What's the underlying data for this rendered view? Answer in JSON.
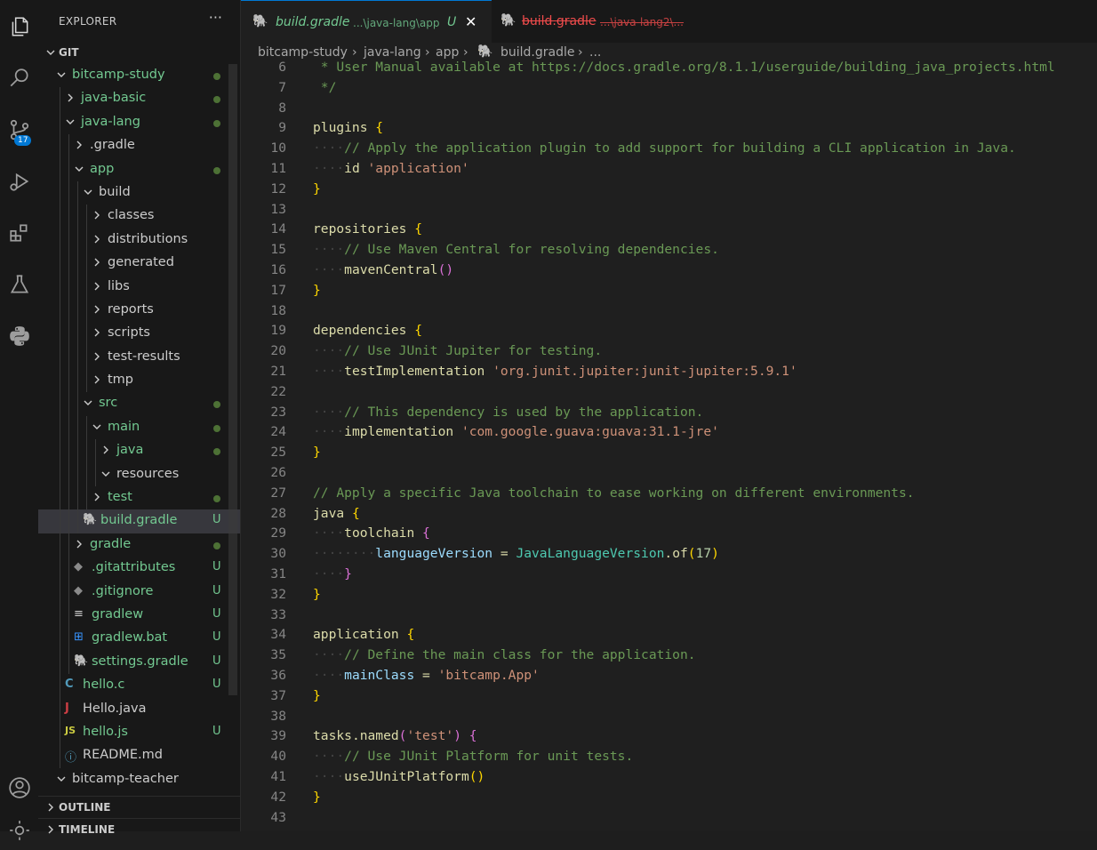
{
  "explorer": {
    "title": "EXPLORER",
    "more": "···",
    "root": "GIT"
  },
  "tree": [
    {
      "label": "bitcamp-study",
      "depth": 1,
      "type": "folder-open",
      "status": "dot",
      "color": "green"
    },
    {
      "label": "java-basic",
      "depth": 2,
      "type": "folder",
      "status": "dot",
      "color": "green"
    },
    {
      "label": "java-lang",
      "depth": 2,
      "type": "folder-open",
      "status": "dot",
      "color": "green"
    },
    {
      "label": ".gradle",
      "depth": 3,
      "type": "folder",
      "status": "",
      "color": "white"
    },
    {
      "label": "app",
      "depth": 3,
      "type": "folder-open",
      "status": "dot",
      "color": "green"
    },
    {
      "label": "build",
      "depth": 4,
      "type": "folder-open",
      "status": "",
      "color": "white"
    },
    {
      "label": "classes",
      "depth": 5,
      "type": "folder",
      "status": "",
      "color": "white"
    },
    {
      "label": "distributions",
      "depth": 5,
      "type": "folder",
      "status": "",
      "color": "white"
    },
    {
      "label": "generated",
      "depth": 5,
      "type": "folder",
      "status": "",
      "color": "white"
    },
    {
      "label": "libs",
      "depth": 5,
      "type": "folder",
      "status": "",
      "color": "white"
    },
    {
      "label": "reports",
      "depth": 5,
      "type": "folder",
      "status": "",
      "color": "white"
    },
    {
      "label": "scripts",
      "depth": 5,
      "type": "folder",
      "status": "",
      "color": "white"
    },
    {
      "label": "test-results",
      "depth": 5,
      "type": "folder",
      "status": "",
      "color": "white"
    },
    {
      "label": "tmp",
      "depth": 5,
      "type": "folder",
      "status": "",
      "color": "white"
    },
    {
      "label": "src",
      "depth": 4,
      "type": "folder-open",
      "status": "dot",
      "color": "green"
    },
    {
      "label": "main",
      "depth": 5,
      "type": "folder-open",
      "status": "dot",
      "color": "green"
    },
    {
      "label": "java",
      "depth": 6,
      "type": "folder",
      "status": "dot",
      "color": "green"
    },
    {
      "label": "resources",
      "depth": 6,
      "type": "folder-open",
      "status": "",
      "color": "white"
    },
    {
      "label": "test",
      "depth": 5,
      "type": "folder",
      "status": "dot",
      "color": "green"
    },
    {
      "label": "build.gradle",
      "depth": 4,
      "type": "gradle",
      "status": "U",
      "color": "green",
      "selected": true
    },
    {
      "label": "gradle",
      "depth": 3,
      "type": "folder",
      "status": "dot",
      "color": "green"
    },
    {
      "label": ".gitattributes",
      "depth": 3,
      "type": "git",
      "status": "U",
      "color": "green"
    },
    {
      "label": ".gitignore",
      "depth": 3,
      "type": "git",
      "status": "U",
      "color": "green"
    },
    {
      "label": "gradlew",
      "depth": 3,
      "type": "lines",
      "status": "U",
      "color": "green"
    },
    {
      "label": "gradlew.bat",
      "depth": 3,
      "type": "windows",
      "status": "U",
      "color": "green"
    },
    {
      "label": "settings.gradle",
      "depth": 3,
      "type": "gradle",
      "status": "U",
      "color": "green"
    },
    {
      "label": "hello.c",
      "depth": 2,
      "type": "c",
      "status": "U",
      "color": "green"
    },
    {
      "label": "Hello.java",
      "depth": 2,
      "type": "java",
      "status": "",
      "color": "white"
    },
    {
      "label": "hello.js",
      "depth": 2,
      "type": "js",
      "status": "U",
      "color": "green"
    },
    {
      "label": "README.md",
      "depth": 2,
      "type": "info",
      "status": "",
      "color": "white"
    },
    {
      "label": "bitcamp-teacher",
      "depth": 1,
      "type": "folder-open",
      "status": "",
      "color": "white"
    }
  ],
  "panels": {
    "outline": "OUTLINE",
    "timeline": "TIMELINE"
  },
  "tabs": [
    {
      "name": "build.gradle",
      "path": "...\\java-lang\\app",
      "status": "U",
      "active": true
    },
    {
      "name": "build.gradle",
      "path": "...\\java-lang2\\...",
      "status": "",
      "active": false
    }
  ],
  "breadcrumb": [
    "bitcamp-study",
    "java-lang",
    "app",
    "build.gradle",
    "..."
  ],
  "activity": {
    "scm_badge": "17"
  },
  "code": [
    {
      "n": "6",
      "segs": [
        [
          "cm",
          " * User Manual available at https://docs.gradle.org/8.1.1/userguide/building_java_projects.html"
        ]
      ]
    },
    {
      "n": "7",
      "segs": [
        [
          "cm",
          " */"
        ]
      ]
    },
    {
      "n": "8",
      "segs": []
    },
    {
      "n": "9",
      "segs": [
        [
          "kw",
          "plugins "
        ],
        [
          "br1",
          "{"
        ]
      ]
    },
    {
      "n": "10",
      "segs": [
        [
          "ws",
          "····"
        ],
        [
          "cm",
          "// Apply the application plugin to add support for building a CLI application in Java."
        ]
      ]
    },
    {
      "n": "11",
      "segs": [
        [
          "ws",
          "····"
        ],
        [
          "kw",
          "id "
        ],
        [
          "st2",
          "'application'"
        ]
      ]
    },
    {
      "n": "12",
      "segs": [
        [
          "br1",
          "}"
        ]
      ]
    },
    {
      "n": "13",
      "segs": []
    },
    {
      "n": "14",
      "segs": [
        [
          "kw",
          "repositories "
        ],
        [
          "br1",
          "{"
        ]
      ]
    },
    {
      "n": "15",
      "segs": [
        [
          "ws",
          "····"
        ],
        [
          "cm",
          "// Use Maven Central for resolving dependencies."
        ]
      ]
    },
    {
      "n": "16",
      "segs": [
        [
          "ws",
          "····"
        ],
        [
          "kw",
          "mavenCentral"
        ],
        [
          "br2",
          "()"
        ]
      ]
    },
    {
      "n": "17",
      "segs": [
        [
          "br1",
          "}"
        ]
      ]
    },
    {
      "n": "18",
      "segs": []
    },
    {
      "n": "19",
      "segs": [
        [
          "kw",
          "dependencies "
        ],
        [
          "br1",
          "{"
        ]
      ]
    },
    {
      "n": "20",
      "segs": [
        [
          "ws",
          "····"
        ],
        [
          "cm",
          "// Use JUnit Jupiter for testing."
        ]
      ]
    },
    {
      "n": "21",
      "segs": [
        [
          "ws",
          "····"
        ],
        [
          "kw",
          "testImplementation "
        ],
        [
          "st2",
          "'org.junit.jupiter:junit-jupiter:5.9.1'"
        ]
      ]
    },
    {
      "n": "22",
      "segs": []
    },
    {
      "n": "23",
      "segs": [
        [
          "ws",
          "····"
        ],
        [
          "cm",
          "// This dependency is used by the application."
        ]
      ]
    },
    {
      "n": "24",
      "segs": [
        [
          "ws",
          "····"
        ],
        [
          "kw",
          "implementation "
        ],
        [
          "st2",
          "'com.google.guava:guava:31.1-jre'"
        ]
      ]
    },
    {
      "n": "25",
      "segs": [
        [
          "br1",
          "}"
        ]
      ]
    },
    {
      "n": "26",
      "segs": []
    },
    {
      "n": "27",
      "segs": [
        [
          "cm",
          "// Apply a specific Java toolchain to ease working on different environments."
        ]
      ]
    },
    {
      "n": "28",
      "segs": [
        [
          "kw",
          "java "
        ],
        [
          "br1",
          "{"
        ]
      ]
    },
    {
      "n": "29",
      "segs": [
        [
          "ws",
          "····"
        ],
        [
          "kw",
          "toolchain "
        ],
        [
          "br2",
          "{"
        ]
      ]
    },
    {
      "n": "30",
      "segs": [
        [
          "ws",
          "········"
        ],
        [
          "id",
          "languageVersion"
        ],
        [
          "kw",
          " = "
        ],
        [
          "cl",
          "JavaLanguageVersion"
        ],
        [
          "kw",
          "."
        ],
        [
          "kw",
          "of"
        ],
        [
          "br1",
          "("
        ],
        [
          "nm",
          "17"
        ],
        [
          "br1",
          ")"
        ]
      ]
    },
    {
      "n": "31",
      "segs": [
        [
          "ws",
          "····"
        ],
        [
          "br2",
          "}"
        ]
      ]
    },
    {
      "n": "32",
      "segs": [
        [
          "br1",
          "}"
        ]
      ]
    },
    {
      "n": "33",
      "segs": []
    },
    {
      "n": "34",
      "segs": [
        [
          "kw",
          "application "
        ],
        [
          "br1",
          "{"
        ]
      ]
    },
    {
      "n": "35",
      "segs": [
        [
          "ws",
          "····"
        ],
        [
          "cm",
          "// Define the main class for the application."
        ]
      ]
    },
    {
      "n": "36",
      "segs": [
        [
          "ws",
          "····"
        ],
        [
          "id",
          "mainClass"
        ],
        [
          "kw",
          " = "
        ],
        [
          "st2",
          "'bitcamp.App'"
        ]
      ]
    },
    {
      "n": "37",
      "segs": [
        [
          "br1",
          "}"
        ]
      ]
    },
    {
      "n": "38",
      "segs": []
    },
    {
      "n": "39",
      "segs": [
        [
          "kw",
          "tasks"
        ],
        [
          "kw",
          "."
        ],
        [
          "kw",
          "named"
        ],
        [
          "br2",
          "("
        ],
        [
          "st2",
          "'test'"
        ],
        [
          "br2",
          ")"
        ],
        [
          "kw",
          " "
        ],
        [
          "br2",
          "{"
        ]
      ]
    },
    {
      "n": "40",
      "segs": [
        [
          "ws",
          "····"
        ],
        [
          "cm",
          "// Use JUnit Platform for unit tests."
        ]
      ]
    },
    {
      "n": "41",
      "segs": [
        [
          "ws",
          "····"
        ],
        [
          "kw",
          "useJUnitPlatform"
        ],
        [
          "br1",
          "()"
        ]
      ]
    },
    {
      "n": "42",
      "segs": [
        [
          "br1",
          "}"
        ]
      ]
    },
    {
      "n": "43",
      "segs": []
    }
  ]
}
